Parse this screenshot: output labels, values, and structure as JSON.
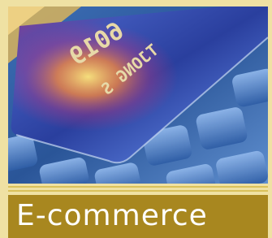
{
  "card": {
    "number_fragment": "6019",
    "name_fragment": "TJONG S"
  },
  "caption": {
    "text": "E-commerce"
  },
  "colors": {
    "frame": "#efe1a3",
    "caption_bar": "#a8871f",
    "rule": "#d9c15a",
    "caption_text": "#ffffff"
  }
}
